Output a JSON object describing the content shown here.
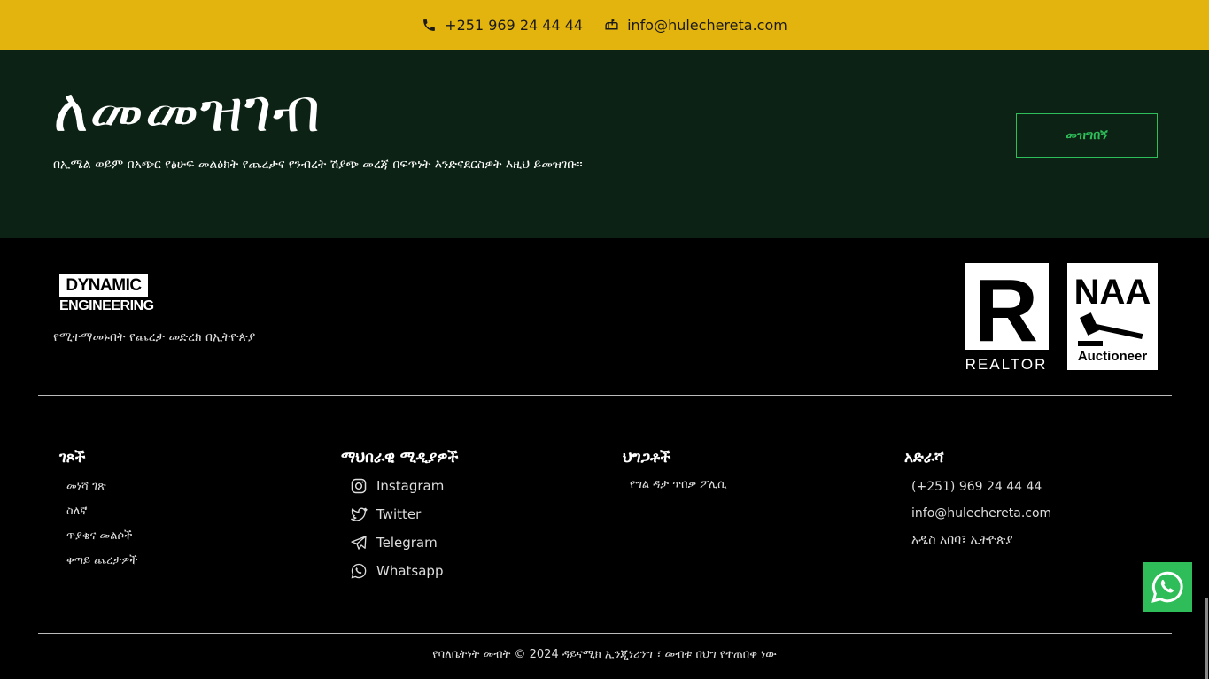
{
  "topbar": {
    "phone": "+251 969 24 44 44",
    "email": "info@hulechereta.com"
  },
  "subscribe": {
    "title": "ለመመዝገብ",
    "description": "በኢሜል ወይም በአጭር የፅሁፍ መልዕክት የጨረታና የንብረት ሽያጭ መረጃ በፍጥነት እንድናደርስዎት እዚህ ይመዝገቡ።",
    "cta_label": "መዝግበኝ"
  },
  "brand": {
    "logo_line1": "DYNAMIC",
    "logo_line2": "ENGINEERING",
    "tagline": "የሚተማመኑበት የጨረታ መድረክ በኢትዮጵያ"
  },
  "badges": {
    "realtor_letter": "R",
    "realtor_label": "REALTOR",
    "naa_label": "NAA",
    "auctioneer_label": "Auctioneer"
  },
  "columns": {
    "pages": {
      "title": "ገጾች",
      "items": [
        "መነሻ ገጽ",
        "ስለኛ",
        "ጥያቄና መልሶች",
        "ቀጣይ ጨረታዎች"
      ]
    },
    "social": {
      "title": "ማህበራዊ ሚዲያዎች",
      "items": [
        {
          "label": "Instagram",
          "icon": "instagram-icon"
        },
        {
          "label": "Twitter",
          "icon": "twitter-icon"
        },
        {
          "label": "Telegram",
          "icon": "telegram-icon"
        },
        {
          "label": "Whatsapp",
          "icon": "whatsapp-icon"
        }
      ]
    },
    "policies": {
      "title": "ህግጋቶች",
      "items": [
        "የግል ዳታ ጥበቃ ፖሊሲ"
      ]
    },
    "address": {
      "title": "አድራሻ",
      "items": [
        "(+251) 969 24 44 44",
        "info@hulechereta.com",
        "አዲስ አበባ፣ ኢትዮጵያ"
      ]
    }
  },
  "copyright": "የባለቤትነት መብት © 2024 ዳይናሚክ ኢንጂነሪንግ ፣ መብቱ በህግ የተጠበቀ ነው",
  "colors": {
    "topbar": "#e3b40e",
    "subscribe_bg": "#0c2214",
    "accent_green": "#2ebf5a",
    "footer_bg": "#000000"
  }
}
